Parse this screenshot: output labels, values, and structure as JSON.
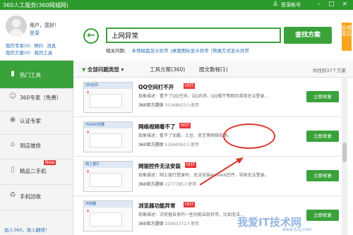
{
  "titlebar": {
    "title": "360人工服务(360网城网)",
    "login": "登录帐号",
    "window_buttons": "– □ ×"
  },
  "sidebar": {
    "greeting": "用户，您好！",
    "login_link": "登录",
    "links": [
      "我的专家(0)",
      "预约",
      "消息",
      "我的方案(0)",
      "我的工具"
    ],
    "nav": [
      {
        "label": "热门工具",
        "icon": "hot-tools-icon",
        "glyph": "▮",
        "active": true
      },
      {
        "label": "360专家（免费）",
        "icon": "expert-icon",
        "glyph": "☺",
        "active": false
      },
      {
        "label": "认证专家",
        "icon": "certified-icon",
        "glyph": "◉",
        "active": false
      },
      {
        "label": "到店维修",
        "icon": "store-icon",
        "glyph": "⌂",
        "active": false
      },
      {
        "label": "精品二手机",
        "icon": "phone-icon",
        "glyph": "▯",
        "active": false,
        "badge": "New"
      },
      {
        "label": "手机回收",
        "icon": "recycle-icon",
        "glyph": "♻",
        "active": false
      }
    ],
    "add_fav": "加入360，收入翻倍！"
  },
  "search": {
    "value": "上网异常",
    "button": "查找方案",
    "related_label": "相关问题：",
    "related": [
      "本地磁盘显示异常",
      "桌面图标显示异常",
      "快捷方式显示异常"
    ]
  },
  "side_tag": "反馈意见",
  "tabs": {
    "items": [
      "全部问题类型",
      "工具方案(360)",
      "图文教程(1)"
    ],
    "found": "共找到37个方案"
  },
  "results": [
    {
      "title": "QQ空间打不开",
      "hot": "HOT",
      "thumb": "QQ空间",
      "desc": "现象描述：看不了QQ空间、QQ农场、QQ餐厅等网页游戏无法登录...",
      "provider": "360官方提供",
      "users": "35368653人使用",
      "button": "立即修复"
    },
    {
      "title": "网络视频看不了",
      "hot": "HOT",
      "thumb": "YOUKU优酷",
      "desc": "现象描述：看不了优酷、土豆、奇艺等网络视频。",
      "provider": "360官方提供",
      "users": "51690062人使用",
      "button": "立即修复"
    },
    {
      "title": "网银控件无法安装",
      "hot": "HOT",
      "thumb": "网上银行",
      "desc": "现象描述：网上银行登录时，无法安装ActiveX控件，导致无法登录。",
      "provider": "360官方提供",
      "users": "2277785人使用",
      "button": "立即修复"
    },
    {
      "title": "浏览器功能异常",
      "hot": "HOT",
      "thumb": "浏览器",
      "desc": "现象描述：浏览器自身的一些功能出现异常，比如无法...",
      "provider": "360官方提供",
      "users": "10493372人使用",
      "button": "立即修复"
    }
  ],
  "watermark": {
    "text": "我爱IT技术网",
    "url": "www.52ij.com"
  },
  "colors": {
    "brand_green": "#3aa23a",
    "titlebar_green": "#2d9a2d",
    "hot_red": "#e83b3b",
    "annotation_red": "#d9362c"
  }
}
